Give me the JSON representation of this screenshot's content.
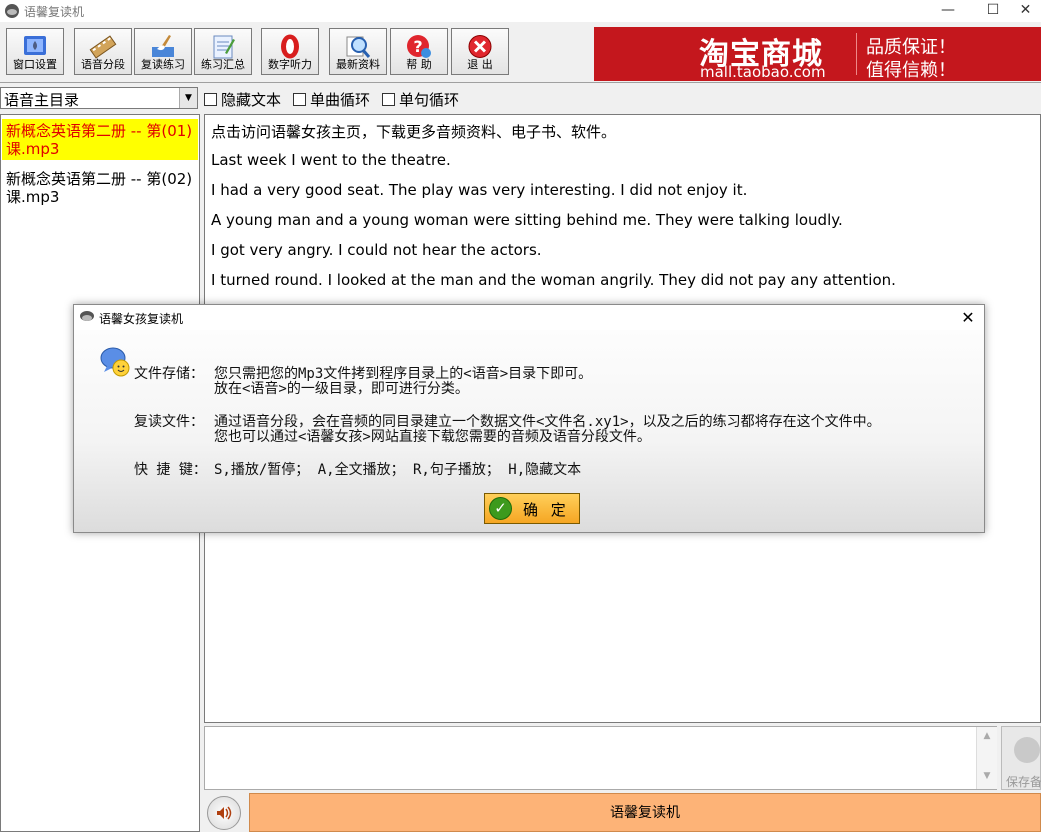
{
  "window": {
    "title": "语馨复读机",
    "minimize_glyph": "—",
    "maximize_glyph": "☐",
    "close_glyph": "✕"
  },
  "toolbar": {
    "buttons": [
      {
        "label": "窗口设置",
        "icon": "window-settings-icon"
      },
      {
        "label": "语音分段",
        "icon": "film-segment-icon"
      },
      {
        "label": "复读练习",
        "icon": "brush-practice-icon"
      },
      {
        "label": "练习汇总",
        "icon": "notebook-summary-icon"
      },
      {
        "label": "数字听力",
        "icon": "zero-digit-icon"
      },
      {
        "label": "最新资料",
        "icon": "magnifier-icon"
      },
      {
        "label": "帮 助",
        "icon": "help-icon"
      },
      {
        "label": "退 出",
        "icon": "exit-icon"
      }
    ]
  },
  "banner": {
    "logo": "淘宝商城",
    "url": "mall.taobao.com",
    "slogan1": "品质保证！",
    "slogan2": "值得信赖！"
  },
  "options": {
    "directory_selected": "语音主目录",
    "hide_text": "隐藏文本",
    "single_track_loop": "单曲循环",
    "single_sentence_loop": "单句循环"
  },
  "files": [
    {
      "name": "新概念英语第二册 -- 第(01)课.mp3",
      "selected": true
    },
    {
      "name": "新概念英语第二册 -- 第(02)课.mp3",
      "selected": false
    }
  ],
  "text_lines": [
    "点击访问语馨女孩主页，下载更多音频资料、电子书、软件。",
    "Last week I went to the theatre.",
    "I had a very good seat. The play was very interesting. I did not enjoy it.",
    "A young man and a young woman were sitting behind me. They were talking loudly.",
    "I got very angry. I could not hear the actors.",
    "I turned round. I looked at the man and the woman angrily. They did not pay any attention."
  ],
  "bottom": {
    "save_label": "保存备",
    "bar_label": "语馨复读机",
    "scroll_up": "▲",
    "scroll_down": "▼",
    "speaker_glyph": "🔊"
  },
  "dialog": {
    "title": "语馨女孩复读机",
    "close_glyph": "✕",
    "storage_label": "文件存储：",
    "storage_line1": "您只需把您的Mp3文件拷到程序目录上的<语音>目录下即可。",
    "storage_line2": "放在<语音>的一级目录，即可进行分类。",
    "repeat_label": "复读文件：",
    "repeat_line1": "通过语音分段，会在音频的同目录建立一个数据文件<文件名.xy1>，以及之后的练习都将存在这个文件中。",
    "repeat_line2": "您也可以通过<语馨女孩>网站直接下载您需要的音频及语音分段文件。",
    "shortcut_label": "快 捷 键：",
    "shortcut_text": "S,播放/暂停；   A,全文播放；   R,句子播放；   H,隐藏文本",
    "ok_label": "确 定",
    "ok_glyph": "✓"
  },
  "colors": {
    "selected_file_bg": "#ffff00",
    "selected_file_text": "#e00000",
    "banner_bg": "#c4171d",
    "bottom_bar_bg": "#fdb377",
    "ok_button": "#f5a623"
  }
}
